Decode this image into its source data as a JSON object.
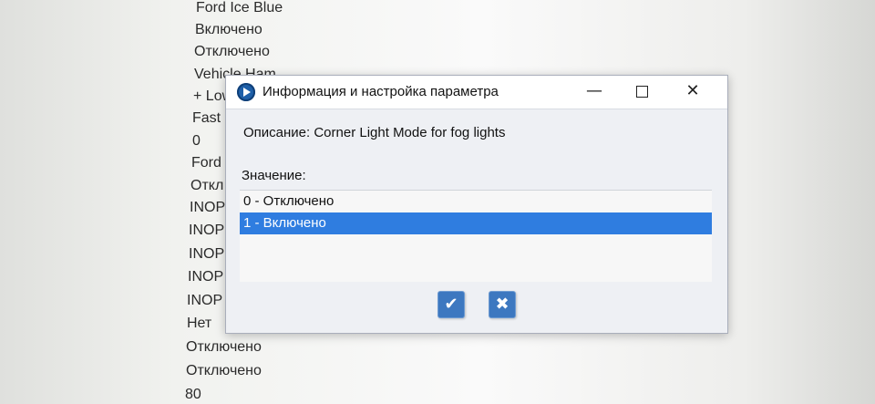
{
  "background_list": [
    "Ford Ice Blue",
    "Включено",
    "Отключено",
    "Vehicle Ham",
    "+ Low",
    "Fast",
    "0",
    "Ford",
    "Откл",
    "INOP",
    "INOP",
    "INOP",
    "INOP",
    "INOP",
    "Нет",
    "Отключено",
    "Отключено",
    "80"
  ],
  "dialog": {
    "title": "Информация и настройка параметра",
    "icon": "app-logo-icon",
    "controls": {
      "minimize": "—",
      "maximize": "maximize-icon",
      "close": "✕"
    },
    "description": "Описание: Corner Light Mode for fog lights",
    "value_label": "Значение:",
    "options": [
      {
        "label": "0 - Отключено",
        "selected": false
      },
      {
        "label": "1 - Включено",
        "selected": true
      }
    ],
    "ok_symbol": "✔",
    "cancel_symbol": "✖"
  },
  "colors": {
    "selection": "#2f7de0",
    "button": "#3d78c0"
  }
}
